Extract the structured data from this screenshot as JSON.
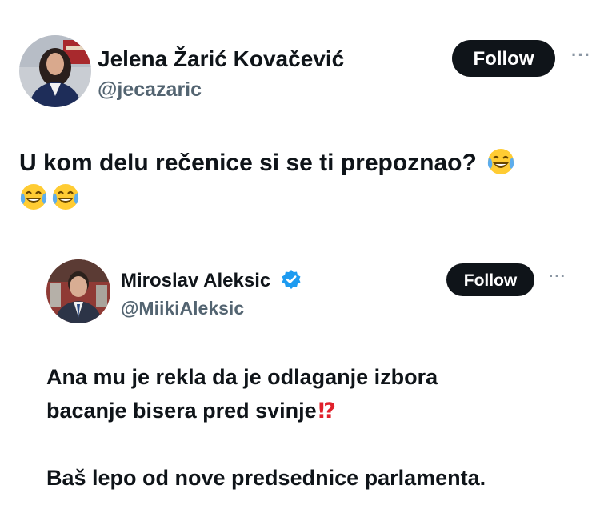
{
  "main_tweet": {
    "author_name": "Jelena Žarić Kovačević",
    "author_handle": "@jecazaric",
    "follow_label": "Follow",
    "more_label": "···",
    "text": "U kom delu rečenice si se ti prepoznao?",
    "emoji": [
      "face-with-tears-of-joy-icon",
      "face-with-tears-of-joy-icon",
      "face-with-tears-of-joy-icon"
    ]
  },
  "quoted_tweet": {
    "author_name": "Miroslav Aleksic",
    "author_handle": "@MiikiAleksic",
    "verified": true,
    "follow_label": "Follow",
    "more_label": "···",
    "lines": [
      "Ana mu je rekla da je odlaganje izbora",
      "bacanje bisera pred svinje",
      "Baš lepo od nove predsednice parlamenta."
    ],
    "interrobang": "⁉"
  },
  "colors": {
    "text": "#0f1419",
    "handle": "#536471",
    "button": "#0f1419",
    "verified": "#1d9bf0",
    "interrobang": "#e0202b"
  }
}
